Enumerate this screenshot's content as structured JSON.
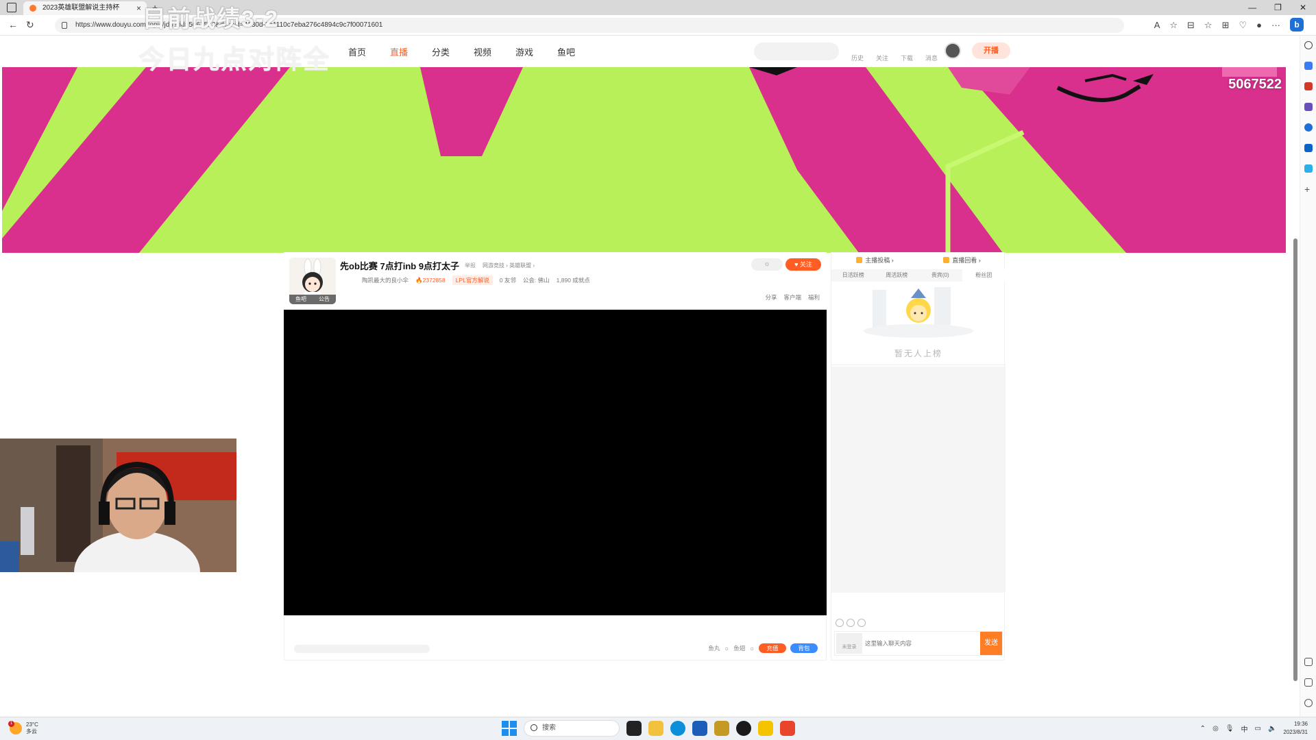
{
  "browser": {
    "tab_title": "2023英雄联盟解说主持杯",
    "tab_close": "×",
    "new_tab": "+",
    "url": "https://www.douyu.com/topic/jdb?rid=5067522&dyshid=4130d-3e1110c7eba276c4894c9c7f00071601",
    "window_controls": [
      "—",
      "❐",
      "✕"
    ],
    "toolbar_icons": [
      "A",
      "☆",
      "⊟",
      "☆",
      "⊞",
      "♡",
      "●",
      "···"
    ],
    "bing_label": "b"
  },
  "overlay": {
    "line1": "目前战绩3-2",
    "line2": "今日九点对阵全"
  },
  "site": {
    "nav": [
      {
        "label": "首页",
        "active": false
      },
      {
        "label": "直播",
        "active": true
      },
      {
        "label": "分类",
        "active": false
      },
      {
        "label": "视频",
        "active": false
      },
      {
        "label": "游戏",
        "active": false
      },
      {
        "label": "鱼吧",
        "active": false
      }
    ],
    "header_links": [
      "历史",
      "关注",
      "下载",
      "消息"
    ],
    "open_live_label": "开播"
  },
  "banner": {
    "room_number": "5067522"
  },
  "room": {
    "title": "先ob比赛 7点打inb 9点打太子",
    "report_label": "举报",
    "category": "网游竞技 › 英雄联盟 ›",
    "avatar_footer": [
      "鱼吧",
      "公告"
    ],
    "streamer_name": "陶凯最大的良小伞",
    "hotness": "2372858",
    "tag": "LPL官方解说",
    "fans": "0 友邻",
    "notice": "公会: 佛山",
    "followers": "1,890 成就点",
    "follow_label": "关注",
    "settings_icon": "☼",
    "actions": [
      "分享",
      "客户端",
      "福利"
    ]
  },
  "controls": {
    "fishball_label": "鱼丸",
    "fishtank_label": "鱼翅",
    "charge_label": "充值",
    "bag_label": "背包"
  },
  "chat": {
    "top_tabs": [
      "主播投稿 ›",
      "直播回看 ›"
    ],
    "rank_tabs": [
      {
        "label": "日活跃榜",
        "active": false
      },
      {
        "label": "周活跃榜",
        "active": false
      },
      {
        "label": "贵宾(0)",
        "active": false
      },
      {
        "label": "粉丝团",
        "active": true
      }
    ],
    "empty_text": "暂无人上榜",
    "input_placeholder": "这里输入聊天内容",
    "level_label": "未登录",
    "send_label": "发送"
  },
  "taskbar": {
    "badge": "1",
    "temperature": "23°C",
    "weather": "多云",
    "search_label": "搜索",
    "tray_lang": "中",
    "time": "19:36",
    "date": "2023/8/31"
  },
  "colors": {
    "accent": "#ff5d23",
    "banner_green": "#b8f05a",
    "banner_pink": "#d8308c"
  }
}
